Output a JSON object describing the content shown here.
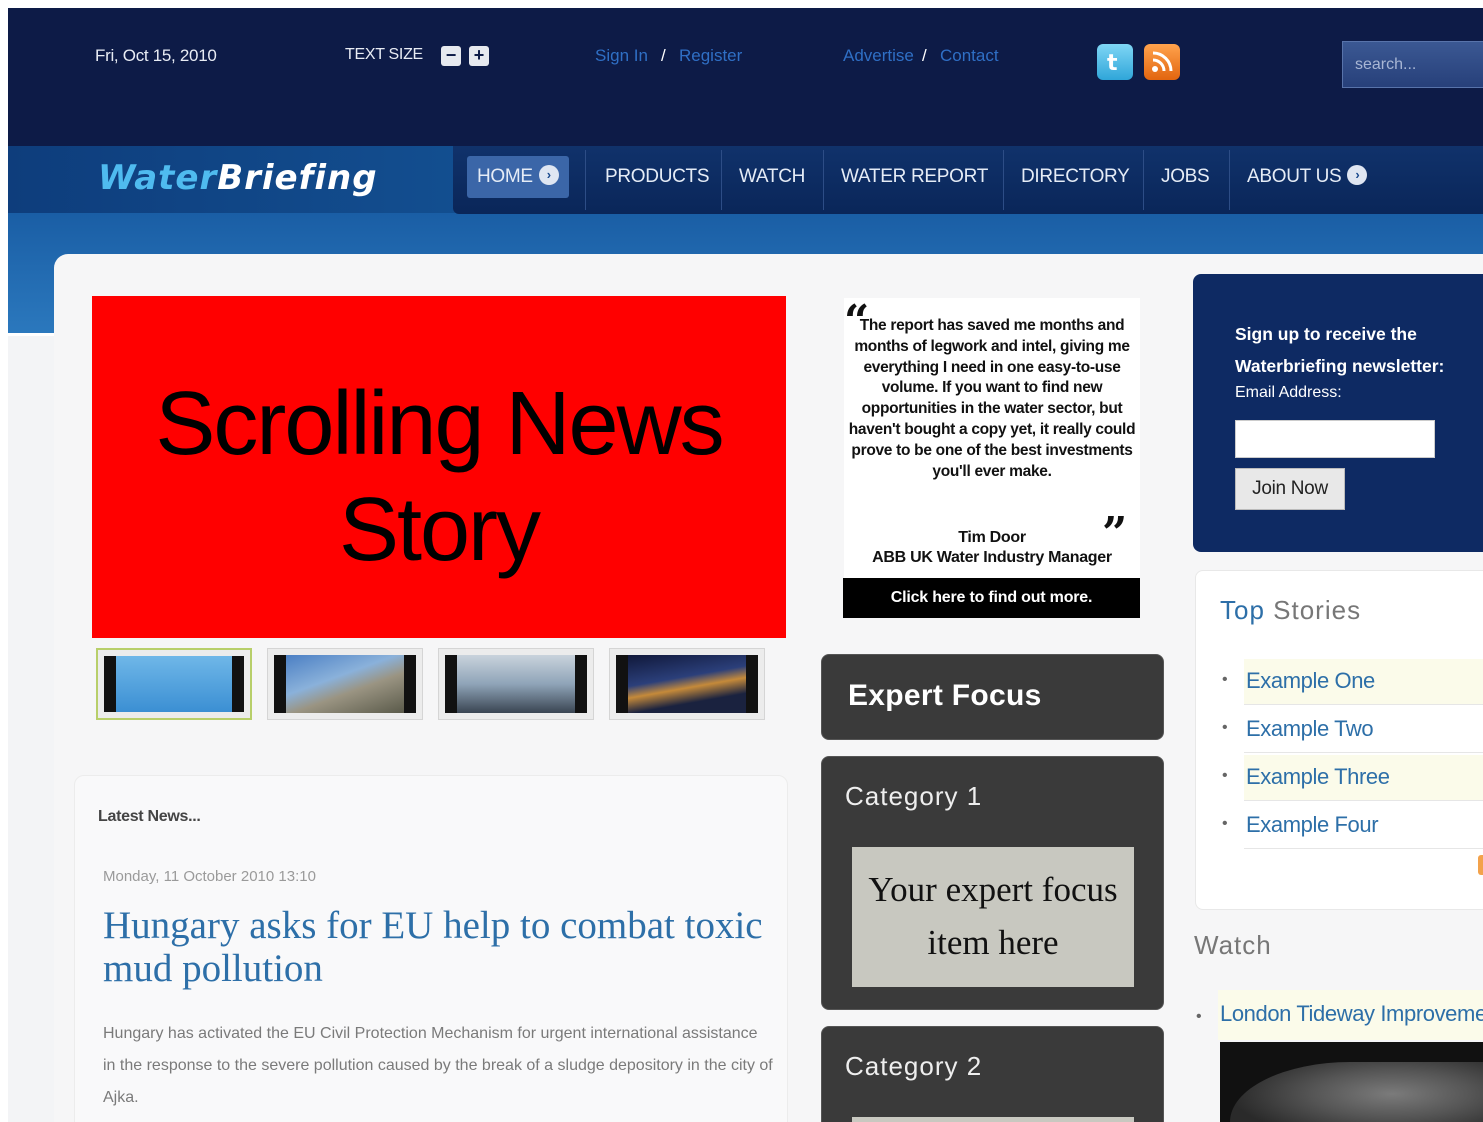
{
  "header": {
    "date": "Fri, Oct 15, 2010",
    "text_size_label": "TEXT SIZE",
    "text_size_minus": "−",
    "text_size_plus": "+",
    "sign_in": "Sign In",
    "sep1": "/",
    "register": "Register",
    "advertise": "Advertise",
    "sep2": "/",
    "contact": "Contact",
    "search_placeholder": "search..."
  },
  "logo": {
    "part1": "Water",
    "part2": "Briefing"
  },
  "nav": {
    "items": [
      "HOME",
      "PRODUCTS",
      "WATCH",
      "WATER REPORT",
      "DIRECTORY",
      "JOBS",
      "ABOUT US"
    ]
  },
  "slider": {
    "text": "Scrolling News Story"
  },
  "news": {
    "label": "Latest News...",
    "date": "Monday, 11 October 2010 13:10",
    "title": "Hungary asks for EU help to combat toxic mud pollution",
    "body": "Hungary has activated the EU Civil Protection Mechanism for urgent international assistance in the response to the severe pollution caused by the break of a sludge depository in the city of Ajka."
  },
  "testimonial": {
    "quote": "The report has saved me months and months of legwork and intel, giving me everything I need in one easy-to-use volume. If you want to find new opportunities in the water sector, but haven't bought a copy yet, it really could prove to be one of the best investments you'll ever make.",
    "name": "Tim Door",
    "role": "ABB UK Water Industry Manager",
    "cta": "Click here to find out more."
  },
  "expert_focus": {
    "title": "Expert Focus",
    "category1": "Category 1",
    "focus_text": "Your expert focus item here",
    "category2": "Category 2"
  },
  "newsletter": {
    "title_line1": "Sign up to receive the",
    "title_line2": "Waterbriefing newsletter:",
    "email_label": "Email Address:",
    "join_label": "Join Now"
  },
  "top_stories": {
    "title_part1": "Top",
    "title_part2": "Stories",
    "items": [
      "Example One",
      "Example Two",
      "Example Three",
      "Example Four"
    ]
  },
  "watch": {
    "title": "Watch",
    "link": "London Tideway Improveme"
  },
  "colors": {
    "header_bg": "#0d1b47",
    "link_blue": "#2d6fa8",
    "slider_red": "#ff0000"
  }
}
